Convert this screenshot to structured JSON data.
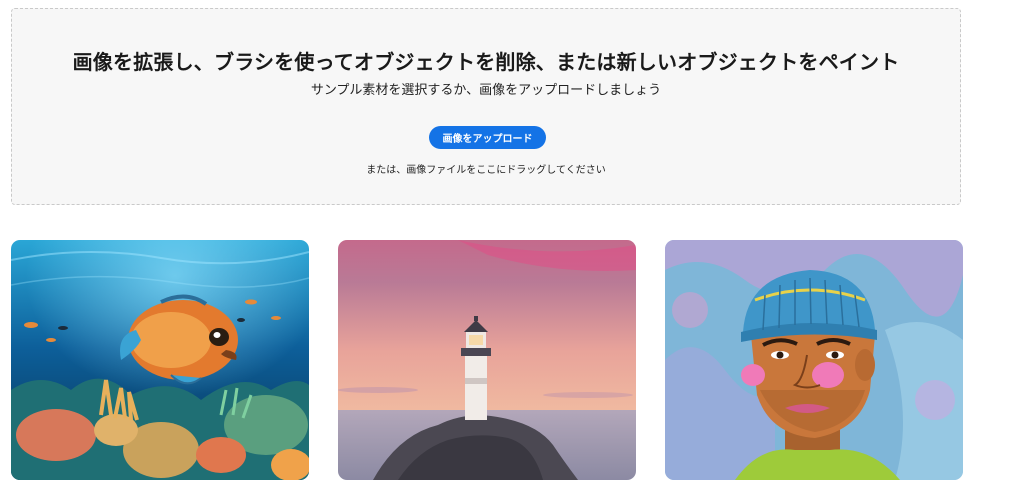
{
  "upload": {
    "title": "画像を拡張し、ブラシを使ってオブジェクトを削除、または新しいオブジェクトをペイント",
    "subtitle": "サンプル素材を選択するか、画像をアップロードしましょう",
    "button_label": "画像をアップロード",
    "drag_hint": "または、画像ファイルをここにドラッグしてください"
  },
  "samples": [
    {
      "subject": "underwater-fish"
    },
    {
      "subject": "lighthouse-sunset"
    },
    {
      "subject": "portrait-beanie"
    }
  ],
  "colors": {
    "accent": "#1473e6",
    "dropzone_bg": "#f7f7f7",
    "dropzone_border": "#c9c9c9"
  }
}
